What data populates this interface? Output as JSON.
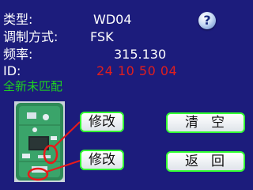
{
  "info": {
    "type_label": "类型:",
    "type_value": "WD04",
    "modulation_label": "调制方式:",
    "modulation_value": "FSK",
    "frequency_label": "频率:",
    "frequency_value": "315.130",
    "id_label": "ID:",
    "id_value": "24 10 50 04"
  },
  "status": "全新未匹配",
  "help": {
    "label": "?"
  },
  "buttons": {
    "edit_1": "修改",
    "edit_2": "修改",
    "clear": "清空",
    "back": "返回"
  },
  "colors": {
    "background": "#1c1c7c",
    "id_value": "#e01e1e",
    "status": "#1fd21f",
    "button_border": "#33ff33",
    "marker": "#e81a1a"
  }
}
